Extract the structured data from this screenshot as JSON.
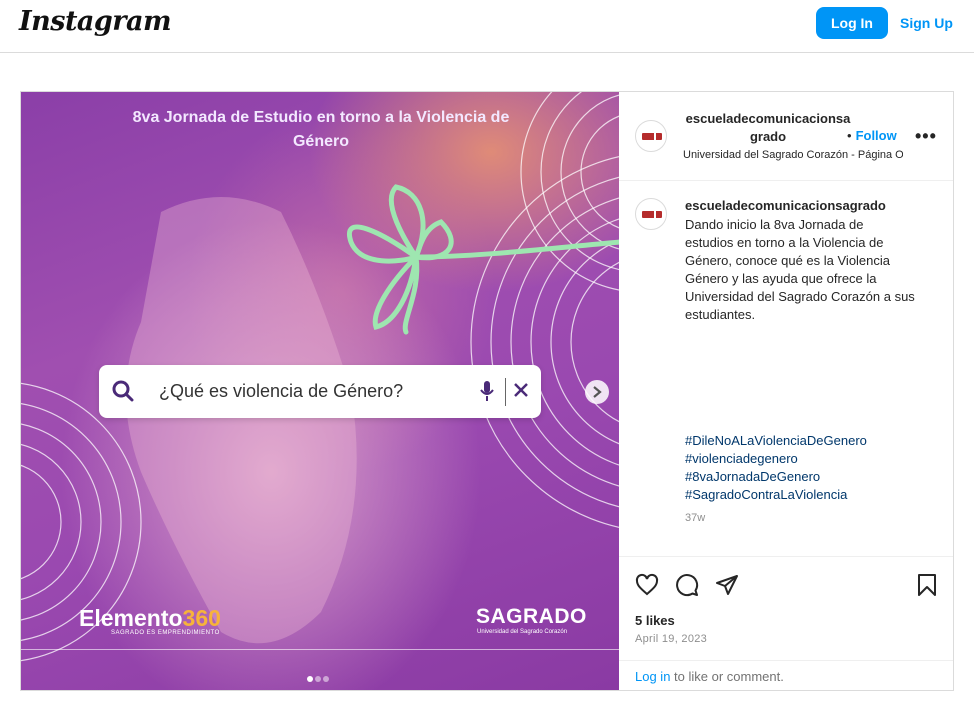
{
  "header": {
    "logo": "Instagram",
    "login_label": "Log In",
    "signup_label": "Sign Up"
  },
  "media": {
    "title": "8va Jornada de Estudio en torno a la Violencia de Género",
    "search_text": "¿Qué es violencia de Género?",
    "brand_left": "Elemento",
    "brand_left_num": "360",
    "brand_left_sub": "SAGRADO ES EMPRENDIMIENTO",
    "brand_right": "SAGRADO",
    "brand_right_sub": "Universidad del Sagrado Corazón",
    "slides": 3,
    "current_slide": 1
  },
  "post_header": {
    "username": "escueladecomunicacionsagrado",
    "bullet": "•",
    "follow_label": "Follow",
    "more": "•••",
    "location": "Universidad del Sagrado Corazón - Página Oficial"
  },
  "caption": {
    "username": "escueladecomunicacionsagrado",
    "text": "Dando inicio la 8va Jornada de estudios en torno a la Violencia de Género, conoce qué es la Violencia Género y las ayuda que ofrece la Universidad del Sagrado Corazón a sus estudiantes.",
    "hashtags": [
      "#DileNoALaViolenciaDeGenero",
      "#violenciadegenero",
      "#8vaJornadaDeGenero",
      "#SagradoContraLaViolencia"
    ],
    "time": "37w"
  },
  "stats": {
    "likes": "5 likes",
    "date": "April 19, 2023"
  },
  "footer": {
    "login_link": "Log in",
    "rest": " to like or comment."
  },
  "colors": {
    "accent": "#0095f6",
    "hashtag": "#00376b",
    "media_purple": "#9a49b0"
  }
}
